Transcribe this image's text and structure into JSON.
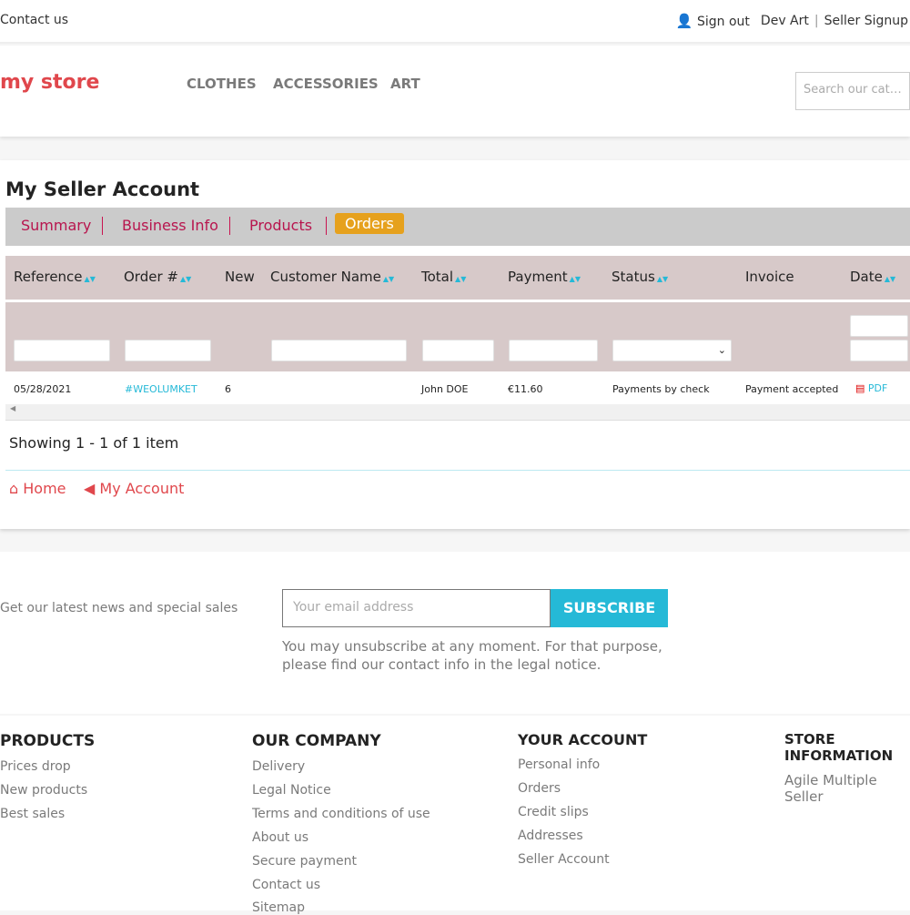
{
  "topbar": {
    "contact": "Contact us",
    "sign_out": "Sign out",
    "user": "Dev Art",
    "seller_signup": "Seller Signup"
  },
  "header": {
    "logo": "my store",
    "nav": [
      "CLOTHES",
      "ACCESSORIES",
      "ART"
    ],
    "search_placeholder": "Search our catalog"
  },
  "account": {
    "title": "My Seller Account",
    "tabs": [
      "Summary",
      "Business Info",
      "Products",
      "Orders"
    ],
    "active_tab": "Orders",
    "columns": [
      "Reference",
      "Order #",
      "New",
      "Customer Name",
      "Total",
      "Payment",
      "Status",
      "Invoice",
      "Date"
    ],
    "rows": [
      {
        "reference": "05/28/2021",
        "order": "#WEOLUMKET",
        "new": "6",
        "customer": "John DOE",
        "total": "€11.60",
        "payment": "Payments by check",
        "status": "Payment accepted",
        "invoice": "PDF"
      }
    ],
    "showing": "Showing 1 - 1 of 1 item",
    "home": "Home",
    "my_account": "My Account"
  },
  "newsletter": {
    "text": "Get our latest news and special sales",
    "placeholder": "Your email address",
    "button": "SUBSCRIBE",
    "note1": "You may unsubscribe at any moment. For that purpose,",
    "note2": "please find our contact info in the legal notice."
  },
  "footer": {
    "products": {
      "title": "PRODUCTS",
      "items": [
        "Prices drop",
        "New products",
        "Best sales"
      ]
    },
    "company": {
      "title": "OUR COMPANY",
      "items": [
        "Delivery",
        "Legal Notice",
        "Terms and conditions of use",
        "About us",
        "Secure payment",
        "Contact us",
        "Sitemap"
      ]
    },
    "account": {
      "title": "YOUR ACCOUNT",
      "items": [
        "Personal info",
        "Orders",
        "Credit slips",
        "Addresses",
        "Seller Account"
      ]
    },
    "store": {
      "title": "STORE INFORMATION",
      "line": "Agile Multiple Seller"
    }
  },
  "colors": {
    "accent": "#25b9d7",
    "tab_active": "#e6a11d",
    "tab_text": "#b8154e",
    "table_head": "#d7c9c9"
  }
}
